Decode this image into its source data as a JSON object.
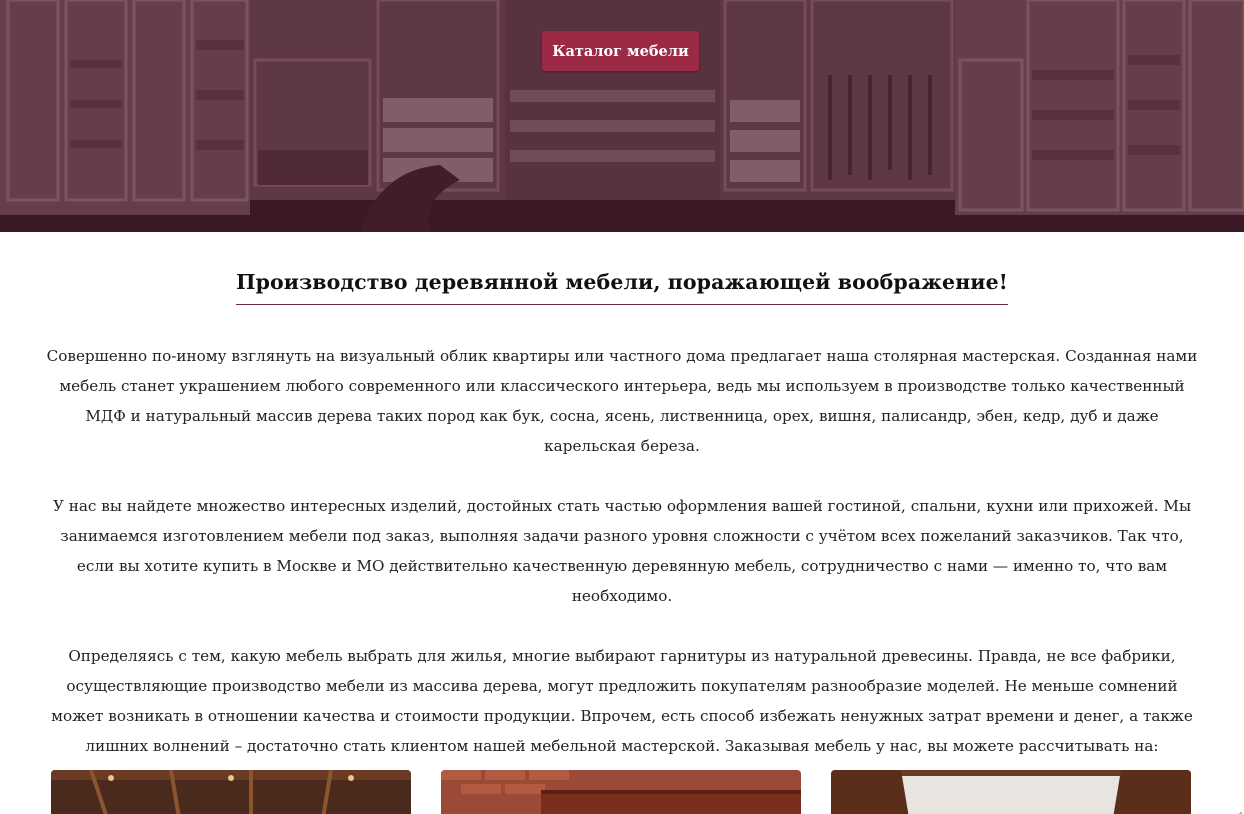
{
  "hero": {
    "catalog_button": "Каталог мебели"
  },
  "main": {
    "title": "Производство деревянной мебели, поражающей воображение!",
    "paragraphs": [
      "Совершенно по-иному взглянуть на визуальный облик квартиры или частного дома предлагает наша столярная мастерская. Созданная нами мебель станет украшением любого современного или классического интерьера, ведь мы используем в производстве только качественный МДФ и натуральный массив дерева таких пород как бук, сосна, ясень, лиственница, орех, вишня, палисандр, эбен, кедр, дуб и даже карельская береза.",
      "У нас вы найдете множество интересных изделий, достойных стать частью оформления вашей гостиной, спальни, кухни или прихожей. Мы занимаемся изготовлением мебели под заказ, выполняя задачи разного уровня сложности с учётом всех пожеланий заказчиков. Так что, если вы хотите купить в Москве и МО действительно качественную деревянную мебель, сотрудничество с нами — именно то, что вам необходимо.",
      "Определяясь с тем, какую мебель выбрать для жилья, многие выбирают гарнитуры из натуральной древесины. Правда, не все фабрики, осуществляющие производство мебели из массива дерева, могут предложить покупателям разнообразие моделей. Не меньше сомнений может возникать в отношении качества и стоимости продукции. Впрочем, есть способ избежать ненужных затрат времени и денег, а также лишних волнений – достаточно стать клиентом нашей мебельной мастерской. Заказывая мебель у нас, вы можете рассчитывать на:"
    ]
  },
  "colors": {
    "accent": "#9d2a45",
    "hero_tint": "#48182c",
    "title_underline": "#6b2a4a"
  }
}
